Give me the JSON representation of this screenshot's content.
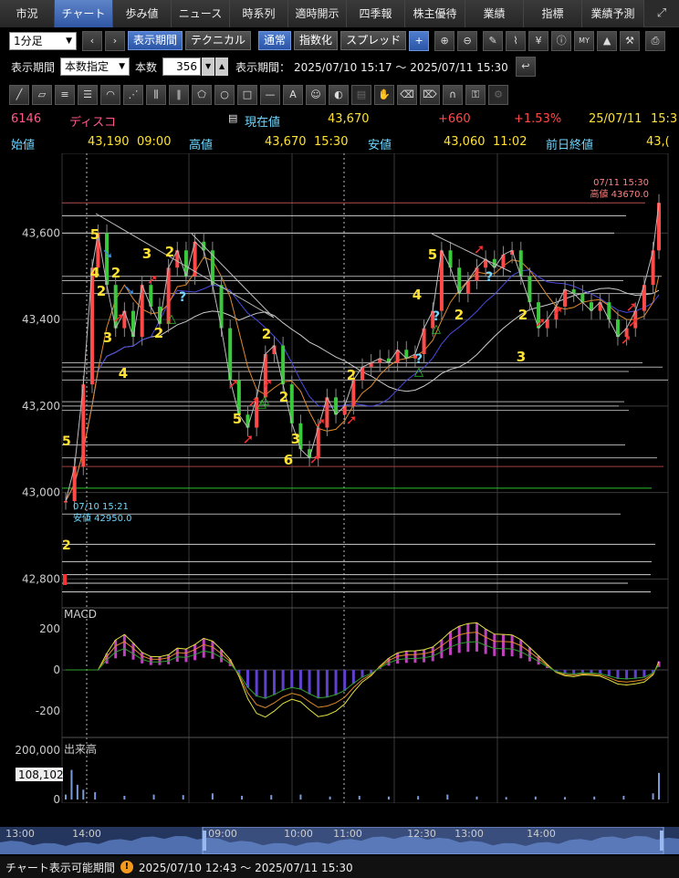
{
  "tabs": [
    "市況",
    "チャート",
    "歩み値",
    "ニュース",
    "時系列",
    "適時開示",
    "四季報",
    "株主優待",
    "業績",
    "指標",
    "業績予測"
  ],
  "toolbar": {
    "interval": "1分足",
    "display_period": "表示期間",
    "technical": "テクニカル",
    "normal": "通常",
    "index": "指数化",
    "spread": "スプレッド",
    "my_icon": "MY"
  },
  "period": {
    "label": "表示期間",
    "mode": "本数指定",
    "count_label": "本数",
    "count": "356",
    "range_label": "表示期間：",
    "range": "2025/07/10 15:17 ～ 2025/07/11 15:30"
  },
  "quote": {
    "code": "6146",
    "name": "ディスコ",
    "current_label": "現在値",
    "current": "43,670",
    "change": "+660",
    "change_pct": "+1.53%",
    "date": "25/07/11",
    "time": "15:3",
    "open_label": "始値",
    "open": "43,190",
    "open_time": "09:00",
    "high_label": "高値",
    "high": "43,670",
    "high_time": "15:30",
    "low_label": "安値",
    "low": "43,060",
    "low_time": "11:02",
    "prev_label": "前日終値",
    "prev": "43,("
  },
  "chart_data": {
    "type": "line",
    "title": "",
    "price_ticks": [
      "43,600",
      "43,400",
      "43,200",
      "43,000",
      "42,800"
    ],
    "macd_label": "MACD",
    "macd_ticks": [
      "200",
      "0",
      "-200"
    ],
    "volume_label": "出来高",
    "volume_ticks": [
      "200,000",
      "0"
    ],
    "volume_last": "108,102",
    "time_ticks": [
      "09:00",
      "10:00",
      "11:00",
      "12:30",
      "13:00",
      "14:00"
    ],
    "high_note": {
      "time": "07/11 15:30",
      "text": "高値 43670.0"
    },
    "low_note": {
      "time": "07/10 15:21",
      "text": "安値 42950.0"
    },
    "ylim": [
      42750,
      43700
    ],
    "price": [
      [
        0,
        42980
      ],
      [
        6,
        43060
      ],
      [
        12,
        43250
      ],
      [
        18,
        43520
      ],
      [
        22,
        43600
      ],
      [
        28,
        43480
      ],
      [
        34,
        43380
      ],
      [
        40,
        43420
      ],
      [
        46,
        43360
      ],
      [
        52,
        43480
      ],
      [
        58,
        43430
      ],
      [
        64,
        43390
      ],
      [
        70,
        43520
      ],
      [
        76,
        43560
      ],
      [
        82,
        43500
      ],
      [
        88,
        43580
      ],
      [
        94,
        43560
      ],
      [
        100,
        43480
      ],
      [
        106,
        43380
      ],
      [
        112,
        43260
      ],
      [
        118,
        43180
      ],
      [
        124,
        43150
      ],
      [
        130,
        43220
      ],
      [
        136,
        43320
      ],
      [
        142,
        43340
      ],
      [
        148,
        43250
      ],
      [
        154,
        43160
      ],
      [
        160,
        43100
      ],
      [
        166,
        43080
      ],
      [
        172,
        43150
      ],
      [
        178,
        43220
      ],
      [
        184,
        43180
      ],
      [
        190,
        43200
      ],
      [
        196,
        43260
      ],
      [
        202,
        43290
      ],
      [
        208,
        43300
      ],
      [
        214,
        43310
      ],
      [
        220,
        43300
      ],
      [
        226,
        43330
      ],
      [
        232,
        43310
      ],
      [
        238,
        43320
      ],
      [
        244,
        43380
      ],
      [
        250,
        43420
      ],
      [
        256,
        43560
      ],
      [
        262,
        43520
      ],
      [
        268,
        43460
      ],
      [
        274,
        43490
      ],
      [
        280,
        43520
      ],
      [
        286,
        43540
      ],
      [
        292,
        43520
      ],
      [
        298,
        43550
      ],
      [
        304,
        43560
      ],
      [
        310,
        43500
      ],
      [
        316,
        43440
      ],
      [
        322,
        43380
      ],
      [
        328,
        43400
      ],
      [
        334,
        43430
      ],
      [
        340,
        43470
      ],
      [
        346,
        43460
      ],
      [
        352,
        43440
      ],
      [
        358,
        43420
      ],
      [
        364,
        43440
      ],
      [
        370,
        43400
      ],
      [
        376,
        43360
      ],
      [
        382,
        43380
      ],
      [
        388,
        43420
      ],
      [
        394,
        43480
      ],
      [
        400,
        43560
      ],
      [
        404,
        43670
      ]
    ],
    "volume": [
      [
        0,
        20000
      ],
      [
        4,
        120000
      ],
      [
        8,
        60000
      ],
      [
        12,
        40000
      ],
      [
        20,
        30000
      ],
      [
        40,
        15000
      ],
      [
        60,
        20000
      ],
      [
        80,
        18000
      ],
      [
        100,
        25000
      ],
      [
        120,
        15000
      ],
      [
        140,
        18000
      ],
      [
        160,
        20000
      ],
      [
        180,
        12000
      ],
      [
        200,
        15000
      ],
      [
        220,
        12000
      ],
      [
        240,
        14000
      ],
      [
        260,
        20000
      ],
      [
        280,
        12000
      ],
      [
        300,
        10000
      ],
      [
        320,
        12000
      ],
      [
        340,
        10000
      ],
      [
        360,
        12000
      ],
      [
        380,
        15000
      ],
      [
        400,
        25000
      ],
      [
        404,
        108102
      ]
    ]
  },
  "navigator": {
    "ticks": [
      "13:00",
      "14:00",
      "09:00",
      "10:00",
      "11:00",
      "12:30",
      "13:00",
      "14:00"
    ]
  },
  "status": {
    "label": "チャート表示可能期間",
    "range": "2025/07/10 12:43 ～ 2025/07/11 15:30"
  },
  "colors": {
    "accent": "#2f57a5",
    "up": "#ff4a4a",
    "price_text": "#ffe233",
    "name": "#ff5a8a",
    "label": "#6fd7ff"
  }
}
